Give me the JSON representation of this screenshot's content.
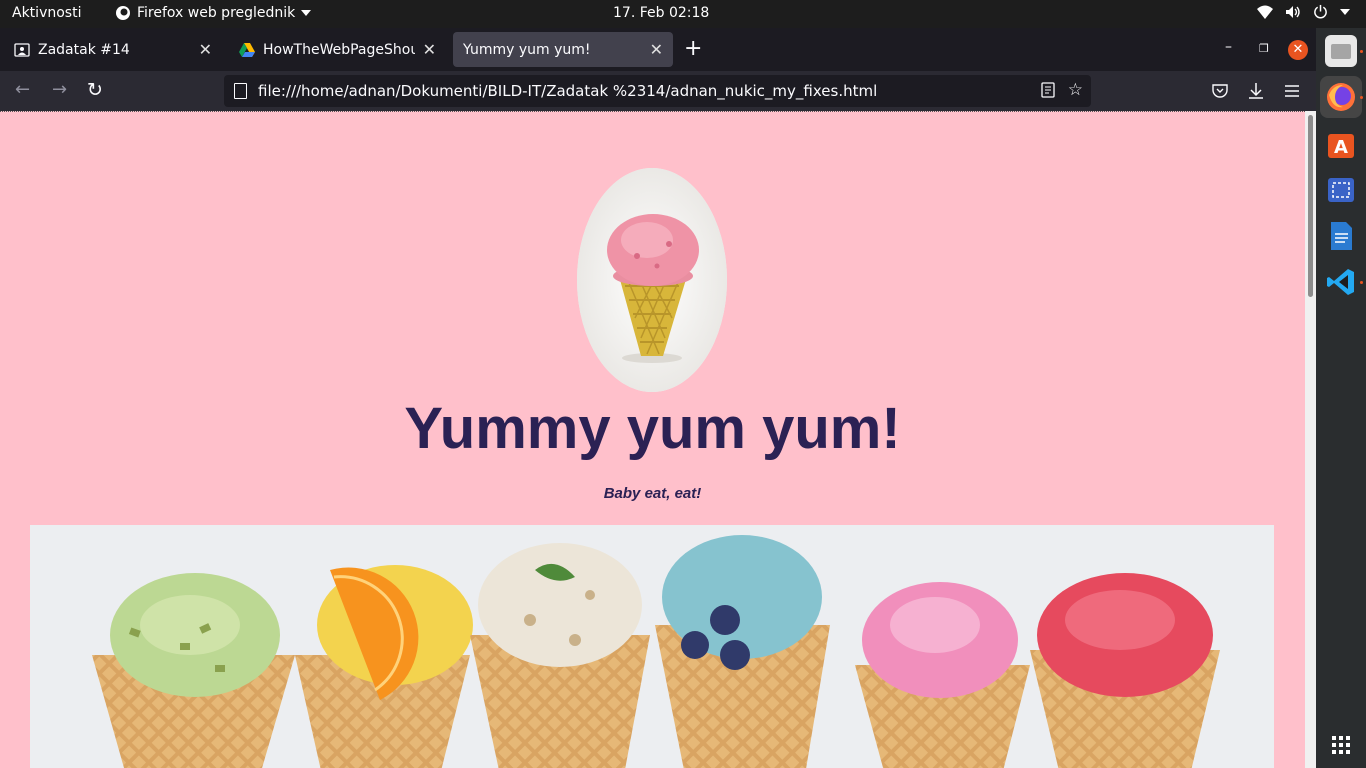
{
  "topbar": {
    "activities": "Aktivnosti",
    "app_name": "Firefox web preglednik",
    "clock": "17. Feb  02:18",
    "icons": [
      "wifi-icon",
      "volume-icon",
      "power-icon",
      "chevron-down-icon"
    ]
  },
  "tabs": [
    {
      "title": "Zadatak #14",
      "favicon": "contact-icon",
      "active": false
    },
    {
      "title": "HowTheWebPageShouldLook",
      "favicon": "google-drive-icon",
      "active": false
    },
    {
      "title": "Yummy yum yum!",
      "favicon": "",
      "active": true
    }
  ],
  "window_controls": [
    "minimize",
    "restore",
    "close"
  ],
  "nav": {
    "url": "file:///home/adnan/Dokumenti/BILD-IT/Zadatak %2314/adnan_nukic_my_fixes.html",
    "buttons": [
      "back-icon",
      "forward-icon",
      "reload-icon",
      "reader-view-icon",
      "bookmark-star-icon",
      "pocket-icon",
      "downloads-icon",
      "menu-icon"
    ]
  },
  "page": {
    "title": "Yummy yum yum!",
    "tagline": "Baby eat, eat!",
    "background": "#ffc0cb",
    "heading_color": "#2b2154",
    "images": [
      "ice-cream-cone-image",
      "ice-cream-cones-banner-image"
    ],
    "banner_flavors": [
      "pistachio",
      "orange",
      "vanilla-nut",
      "blueberry",
      "pink",
      "strawberry"
    ]
  },
  "dock": {
    "apps": [
      "files-icon",
      "firefox-icon",
      "software-center-icon",
      "screenshot-icon",
      "libreoffice-writer-icon",
      "vscode-icon"
    ],
    "show_apps": "app-grid-icon"
  },
  "colors": {
    "accent": "#e95420",
    "tab_active": "#42414d",
    "toolbar": "#2b2a33"
  }
}
